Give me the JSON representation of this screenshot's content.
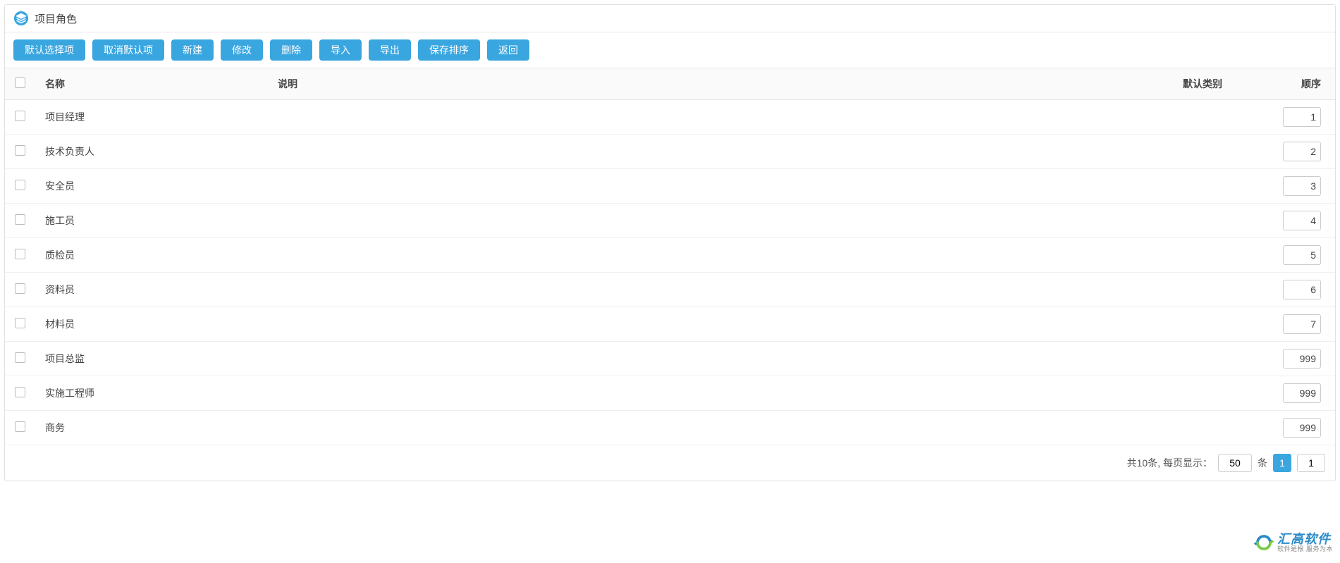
{
  "header": {
    "title": "项目角色"
  },
  "toolbar": {
    "buttons": [
      "默认选择项",
      "取消默认项",
      "新建",
      "修改",
      "删除",
      "导入",
      "导出",
      "保存排序",
      "返回"
    ]
  },
  "table": {
    "columns": {
      "name": "名称",
      "desc": "说明",
      "default": "默认类别",
      "order": "顺序"
    },
    "rows": [
      {
        "name": "项目经理",
        "desc": "",
        "default": "",
        "order": "1"
      },
      {
        "name": "技术负责人",
        "desc": "",
        "default": "",
        "order": "2"
      },
      {
        "name": "安全员",
        "desc": "",
        "default": "",
        "order": "3"
      },
      {
        "name": "施工员",
        "desc": "",
        "default": "",
        "order": "4"
      },
      {
        "name": "质检员",
        "desc": "",
        "default": "",
        "order": "5"
      },
      {
        "name": "资料员",
        "desc": "",
        "default": "",
        "order": "6"
      },
      {
        "name": "材料员",
        "desc": "",
        "default": "",
        "order": "7"
      },
      {
        "name": "项目总监",
        "desc": "",
        "default": "",
        "order": "999"
      },
      {
        "name": "实施工程师",
        "desc": "",
        "default": "",
        "order": "999"
      },
      {
        "name": "商务",
        "desc": "",
        "default": "",
        "order": "999"
      }
    ]
  },
  "footer": {
    "total_prefix": "共",
    "total_count": "10",
    "total_suffix": "条, 每页显示：",
    "page_size": "50",
    "unit": "条",
    "current_page": "1",
    "goto_page": "1"
  },
  "watermark": {
    "brand": "汇高软件",
    "slogan": "软件是根 服务为本"
  }
}
